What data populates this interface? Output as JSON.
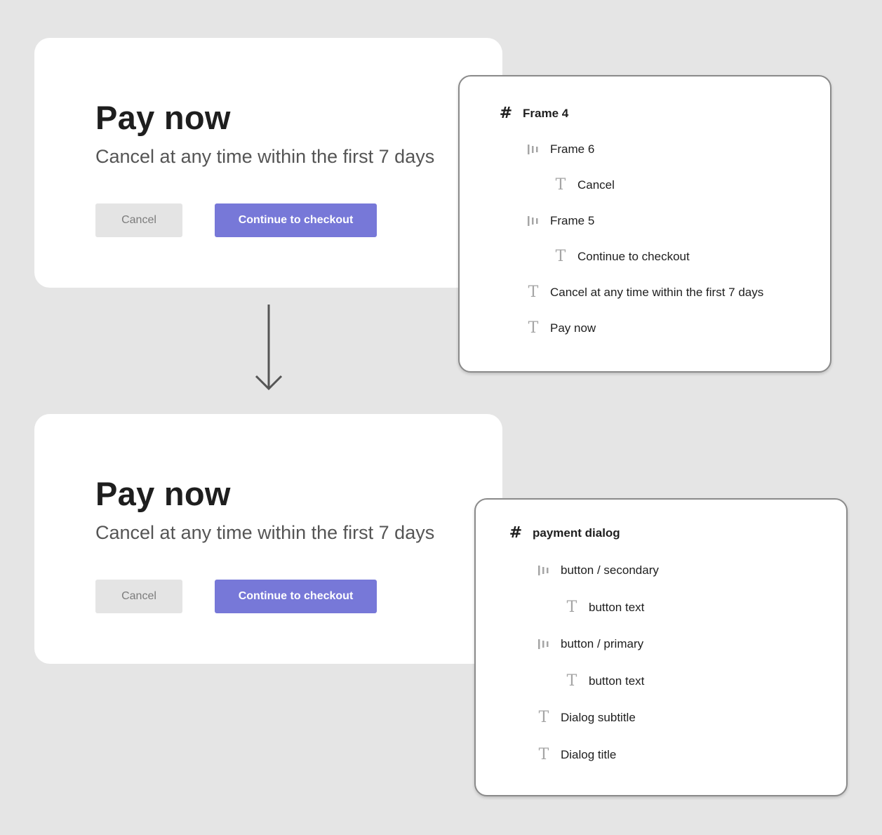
{
  "dialog_before": {
    "title": "Pay now",
    "subtitle": "Cancel at any time within the first 7 days",
    "cancel_label": "Cancel",
    "checkout_label": "Continue to checkout"
  },
  "dialog_after": {
    "title": "Pay now",
    "subtitle": "Cancel at any time within the first 7 days",
    "cancel_label": "Cancel",
    "checkout_label": "Continue to checkout"
  },
  "layers_before": {
    "items": [
      {
        "label": "Frame 4",
        "icon": "frame-hash-icon"
      },
      {
        "label": "Frame 6",
        "icon": "autolayout-icon"
      },
      {
        "label": "Cancel",
        "icon": "text-icon"
      },
      {
        "label": "Frame 5",
        "icon": "autolayout-icon"
      },
      {
        "label": "Continue to checkout",
        "icon": "text-icon"
      },
      {
        "label": "Cancel at any time within the first 7 days",
        "icon": "text-icon"
      },
      {
        "label": "Pay now",
        "icon": "text-icon"
      }
    ]
  },
  "layers_after": {
    "items": [
      {
        "label": "payment dialog",
        "icon": "frame-hash-icon"
      },
      {
        "label": "button / secondary",
        "icon": "autolayout-icon"
      },
      {
        "label": "button text",
        "icon": "text-icon"
      },
      {
        "label": "button / primary",
        "icon": "autolayout-icon"
      },
      {
        "label": "button text",
        "icon": "text-icon"
      },
      {
        "label": "Dialog subtitle",
        "icon": "text-icon"
      },
      {
        "label": "Dialog title",
        "icon": "text-icon"
      }
    ]
  },
  "colors": {
    "background": "#e5e5e5",
    "primary_button": "#7778d8",
    "secondary_button": "#e4e4e4",
    "title_text": "#1e1e1e",
    "icon_gray": "#a5a5a5"
  }
}
